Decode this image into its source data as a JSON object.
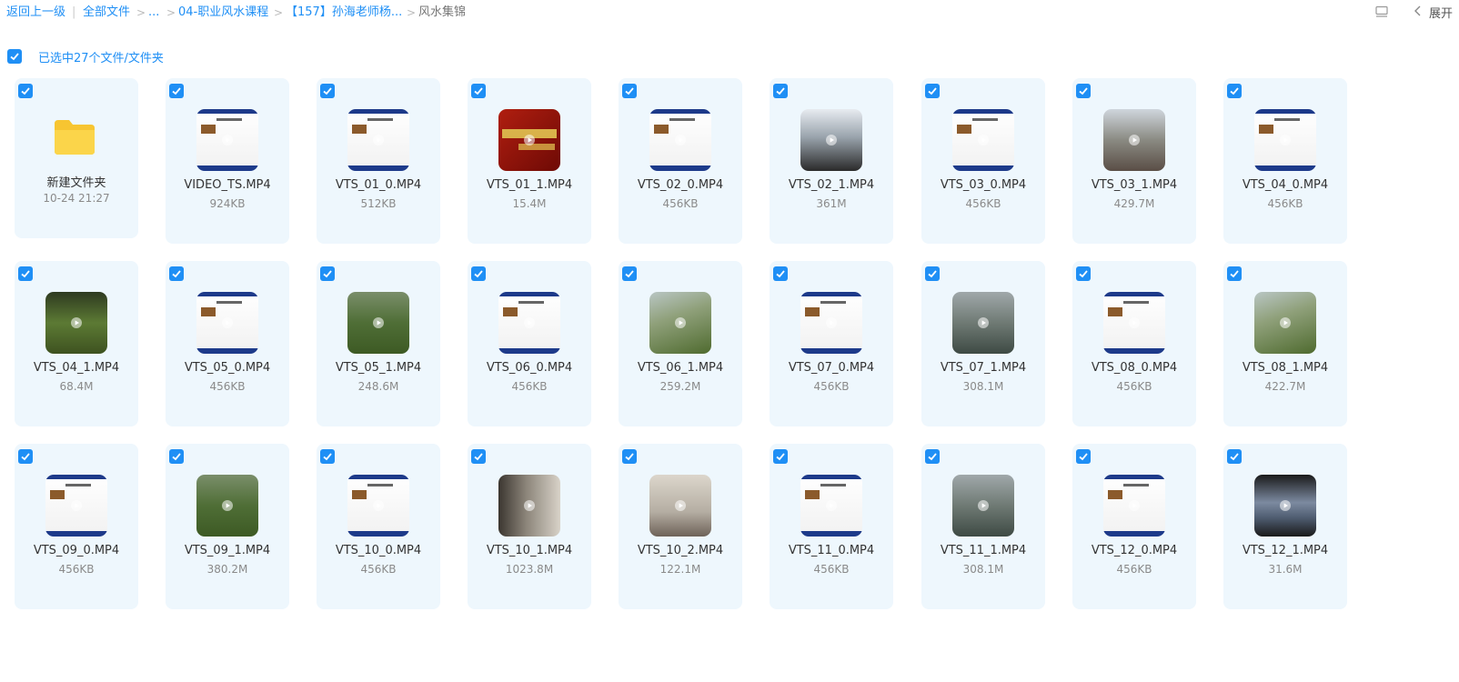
{
  "breadcrumb": {
    "back": "返回上一级",
    "pipe": "|",
    "all_files": "全部文件",
    "sep": ">",
    "ellipsis": "...",
    "level1": "04-职业风水课程",
    "level2": "【157】孙海老师杨...",
    "current": "风水集锦"
  },
  "toolbar": {
    "list_icon": "list-view-icon",
    "collapse_icon": "chevron-left-icon",
    "expand_label": "展开"
  },
  "selection": {
    "text": "已选中27个文件/文件夹",
    "checked": true
  },
  "colors": {
    "accent": "#1f8ff5",
    "card_bg": "#eef7fd",
    "folder": "#f7c531"
  },
  "items": [
    {
      "name": "新建文件夹",
      "meta": "10-24 21:27",
      "kind": "folder",
      "thumb": "folder-icon"
    },
    {
      "name": "VIDEO_TS.MP4",
      "meta": "924KB",
      "kind": "file",
      "thumb": "slide"
    },
    {
      "name": "VTS_01_0.MP4",
      "meta": "512KB",
      "kind": "file",
      "thumb": "slide"
    },
    {
      "name": "VTS_01_1.MP4",
      "meta": "15.4M",
      "kind": "file",
      "thumb": "red"
    },
    {
      "name": "VTS_02_0.MP4",
      "meta": "456KB",
      "kind": "file",
      "thumb": "slide"
    },
    {
      "name": "VTS_02_1.MP4",
      "meta": "361M",
      "kind": "file",
      "thumb": "crowd"
    },
    {
      "name": "VTS_03_0.MP4",
      "meta": "456KB",
      "kind": "file",
      "thumb": "slide"
    },
    {
      "name": "VTS_03_1.MP4",
      "meta": "429.7M",
      "kind": "file",
      "thumb": "temple"
    },
    {
      "name": "VTS_04_0.MP4",
      "meta": "456KB",
      "kind": "file",
      "thumb": "slide"
    },
    {
      "name": "VTS_04_1.MP4",
      "meta": "68.4M",
      "kind": "file",
      "thumb": "dark"
    },
    {
      "name": "VTS_05_0.MP4",
      "meta": "456KB",
      "kind": "file",
      "thumb": "slide"
    },
    {
      "name": "VTS_05_1.MP4",
      "meta": "248.6M",
      "kind": "file",
      "thumb": "forest"
    },
    {
      "name": "VTS_06_0.MP4",
      "meta": "456KB",
      "kind": "file",
      "thumb": "slide"
    },
    {
      "name": "VTS_06_1.MP4",
      "meta": "259.2M",
      "kind": "file",
      "thumb": "green"
    },
    {
      "name": "VTS_07_0.MP4",
      "meta": "456KB",
      "kind": "file",
      "thumb": "slide"
    },
    {
      "name": "VTS_07_1.MP4",
      "meta": "308.1M",
      "kind": "file",
      "thumb": "street"
    },
    {
      "name": "VTS_08_0.MP4",
      "meta": "456KB",
      "kind": "file",
      "thumb": "slide"
    },
    {
      "name": "VTS_08_1.MP4",
      "meta": "422.7M",
      "kind": "file",
      "thumb": "green"
    },
    {
      "name": "VTS_09_0.MP4",
      "meta": "456KB",
      "kind": "file",
      "thumb": "slide"
    },
    {
      "name": "VTS_09_1.MP4",
      "meta": "380.2M",
      "kind": "file",
      "thumb": "forest"
    },
    {
      "name": "VTS_10_0.MP4",
      "meta": "456KB",
      "kind": "file",
      "thumb": "slide"
    },
    {
      "name": "VTS_10_1.MP4",
      "meta": "1023.8M",
      "kind": "file",
      "thumb": "teacher"
    },
    {
      "name": "VTS_10_2.MP4",
      "meta": "122.1M",
      "kind": "file",
      "thumb": "room"
    },
    {
      "name": "VTS_11_0.MP4",
      "meta": "456KB",
      "kind": "file",
      "thumb": "slide"
    },
    {
      "name": "VTS_11_1.MP4",
      "meta": "308.1M",
      "kind": "file",
      "thumb": "street"
    },
    {
      "name": "VTS_12_0.MP4",
      "meta": "456KB",
      "kind": "file",
      "thumb": "slide"
    },
    {
      "name": "VTS_12_1.MP4",
      "meta": "31.6M",
      "kind": "file",
      "thumb": "coast"
    }
  ]
}
